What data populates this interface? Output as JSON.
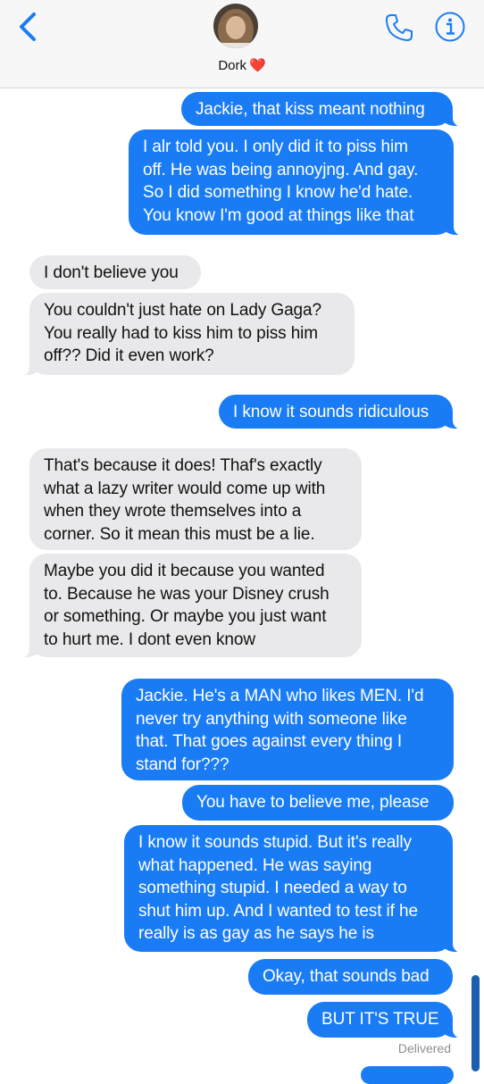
{
  "header": {
    "contact_name": "Dork",
    "contact_emoji": "❤️",
    "back_icon": "chevron-left-icon",
    "call_icon": "phone-icon",
    "info_icon": "info-icon",
    "accent_color": "#1a7cf5"
  },
  "messages": [
    {
      "from": "me",
      "lines": [
        "Jackie, that kiss meant nothing"
      ]
    },
    {
      "from": "me",
      "lines": [
        "I alr told you. I only did it to piss him",
        "off. He was being annoyjng. And gay.",
        "So I did something I know he'd hate.",
        "You know I'm good at things like that"
      ]
    },
    {
      "from": "them",
      "lines": [
        "I don't believe you"
      ]
    },
    {
      "from": "them",
      "lines": [
        "You couldn't just hate on Lady Gaga?",
        "You really had to kiss him to piss him",
        "off?? Did it even work?"
      ]
    },
    {
      "from": "me",
      "lines": [
        "I know it sounds ridiculous"
      ]
    },
    {
      "from": "them",
      "lines": [
        "That's because it does! Thaf's exactly",
        "what a lazy writer would come up with",
        "when they wrote themselves into a",
        "corner. So it mean this must be a lie."
      ]
    },
    {
      "from": "them",
      "lines": [
        "Maybe you did it because you wanted",
        "to. Because he was your Disney crush",
        "or something. Or maybe you just want",
        "to hurt me. I dont even know"
      ]
    },
    {
      "from": "me",
      "lines": [
        "Jackie. He's a MAN who likes MEN. I'd",
        "never try anything with someone like",
        "that. That goes against every thing I",
        "stand for???"
      ]
    },
    {
      "from": "me",
      "lines": [
        "You have to believe me, please"
      ]
    },
    {
      "from": "me",
      "lines": [
        "I know it sounds stupid. But it's really",
        "what happened. He was saying",
        "something stupid. I needed a way to",
        "shut him up. And I wanted to test if he",
        "really is as gay as he says he is"
      ]
    },
    {
      "from": "me",
      "lines": [
        "Okay, that sounds bad"
      ]
    },
    {
      "from": "me",
      "lines": [
        "BUT IT'S TRUE"
      ]
    }
  ],
  "status": {
    "delivered": "Delivered"
  },
  "colors": {
    "sent_bubble": "#1a7cf5",
    "received_bubble": "#e9e9eb"
  }
}
